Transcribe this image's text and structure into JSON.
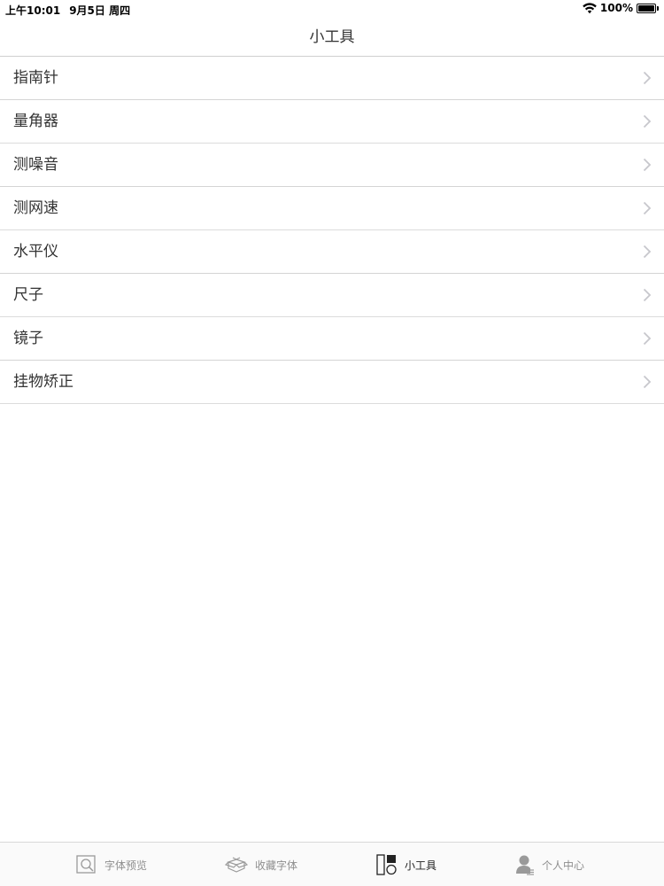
{
  "status_bar": {
    "time": "上午10:01",
    "date": "9月5日 周四",
    "battery": "100%"
  },
  "nav": {
    "title": "小工具"
  },
  "tools": [
    {
      "label": "指南针"
    },
    {
      "label": "量角器"
    },
    {
      "label": "测噪音"
    },
    {
      "label": "测网速"
    },
    {
      "label": "水平仪"
    },
    {
      "label": "尺子"
    },
    {
      "label": "镜子"
    },
    {
      "label": "挂物矫正"
    }
  ],
  "tab_bar": {
    "tabs": [
      {
        "label": "字体预览",
        "icon": "search-document-icon",
        "active": false
      },
      {
        "label": "收藏字体",
        "icon": "open-box-icon",
        "active": false
      },
      {
        "label": "小工具",
        "icon": "tools-icon",
        "active": true
      },
      {
        "label": "个人中心",
        "icon": "person-icon",
        "active": false
      }
    ]
  },
  "colors": {
    "text": "#333333",
    "chevron": "#c7c7cc",
    "separator": "#dcdcdc",
    "tab_inactive": "#8e8e8e",
    "tab_active": "#222222"
  }
}
